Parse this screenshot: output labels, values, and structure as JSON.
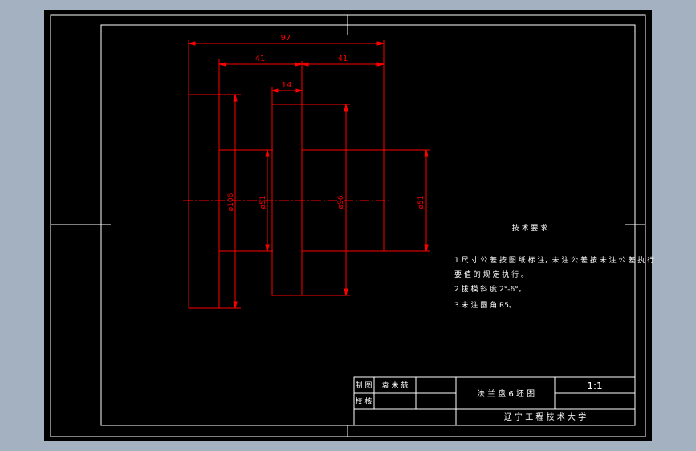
{
  "dimensions": {
    "overall_width": "97",
    "left_width": "41",
    "right_width": "41",
    "hub_width": "14",
    "dia_left": "ø106",
    "dia_left_inner": "ø51",
    "dia_hub": "ø96",
    "dia_right": "ø51"
  },
  "tech_requirements": {
    "title": "技 术 要 求",
    "line1": "1.尺 寸 公 差 按 图 纸 标 注，未 注 公 差 按 未 注 公 差 执 行",
    "line2": "要 值 的 规 定 执 行 。",
    "line3": "2.拔 模 斜 度 2°-6°。",
    "line4": "3.未 注 圆 角 R5。"
  },
  "title_block": {
    "drawing_label": "制 图",
    "check_label": "校 核",
    "drawer_name": "袁 未 兢",
    "part_name": "法 兰 盘 6 坯 图",
    "scale": "1:1",
    "school": "辽 宁 工 程 技 术 大 学"
  },
  "colors": {
    "background": "#000000",
    "frame": "#ffffff",
    "drawing": "#ff0000",
    "text": "#ffffff",
    "desktop": "#a4b1c1"
  }
}
